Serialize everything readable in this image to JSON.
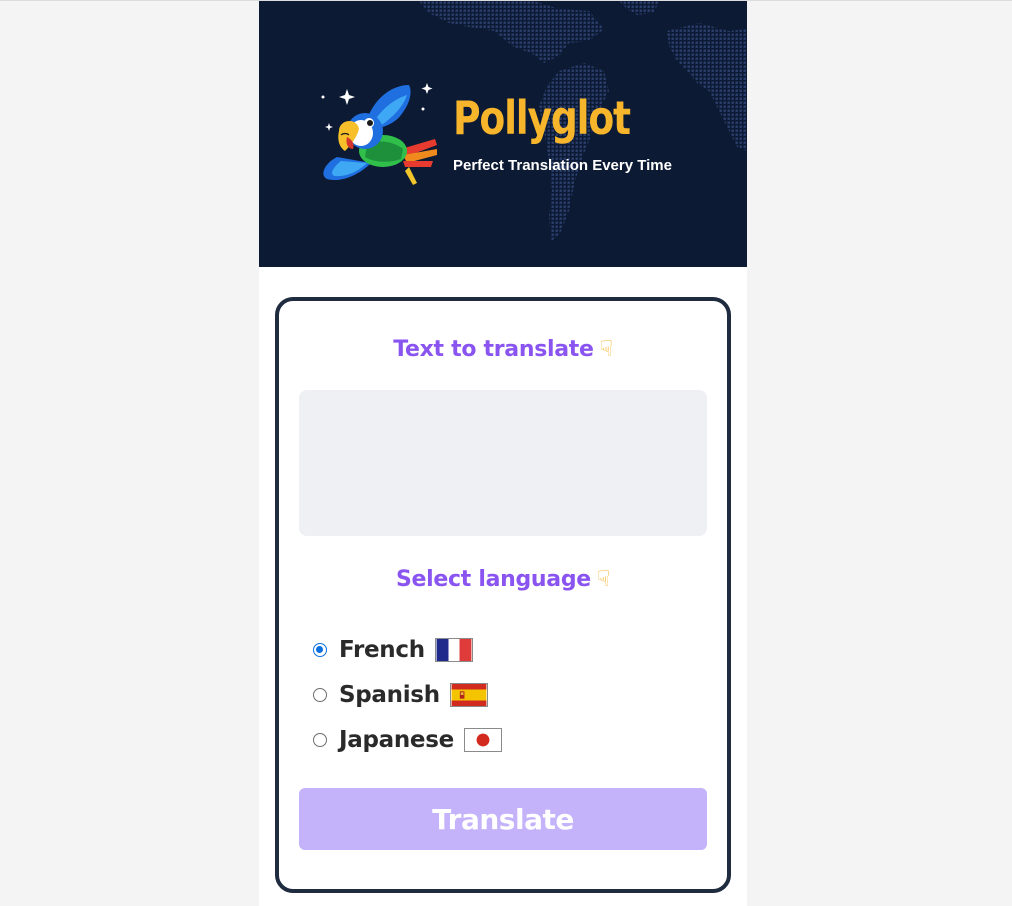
{
  "header": {
    "title": "Pollyglot",
    "subtitle": "Perfect Translation Every Time"
  },
  "input_section": {
    "title": "Text to translate",
    "hand_icon": "pointing-down-hand-icon",
    "textarea_value": ""
  },
  "language_section": {
    "title": "Select language",
    "hand_icon": "pointing-down-hand-icon",
    "options": [
      {
        "label": "French",
        "flag_icon": "flag-france-icon",
        "checked": true
      },
      {
        "label": "Spanish",
        "flag_icon": "flag-spain-icon",
        "checked": false
      },
      {
        "label": "Japanese",
        "flag_icon": "flag-japan-icon",
        "checked": false
      }
    ]
  },
  "translate_button": {
    "label": "Translate"
  },
  "colors": {
    "header_bg": "#0d1a33",
    "brand_yellow": "#f7b52b",
    "accent_purple": "#8a54f0",
    "button_bg": "#c4b3fb",
    "card_border": "#1f2b3e"
  }
}
